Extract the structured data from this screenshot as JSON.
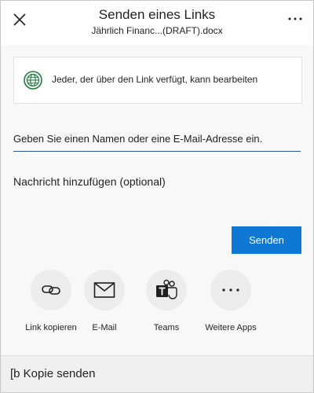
{
  "header": {
    "title": "Senden eines Links",
    "subtitle": "Jährlich Financ...(DRAFT).docx",
    "close_icon": "close-icon",
    "more_icon": "more-horizontal-icon"
  },
  "link_setting": {
    "icon": "globe-icon",
    "text": "Jeder, der über den Link verfügt, kann bearbeiten"
  },
  "recipient": {
    "placeholder": "Geben Sie einen Namen oder eine E-Mail-Adresse ein."
  },
  "message": {
    "placeholder": "Nachricht hinzufügen (optional)"
  },
  "send_button": {
    "label": "Senden"
  },
  "apps": [
    {
      "icon": "link-icon",
      "label": "Link kopieren"
    },
    {
      "icon": "mail-icon",
      "label": "E-Mail"
    },
    {
      "icon": "teams-icon",
      "label": "Teams"
    },
    {
      "icon": "more-horizontal-icon",
      "label": "Weitere Apps"
    }
  ],
  "copy_bar": {
    "label": "[b Kopie senden"
  },
  "colors": {
    "accent": "#0f78d4",
    "globe": "#1e7b3c",
    "input_underline": "#2b5797"
  }
}
